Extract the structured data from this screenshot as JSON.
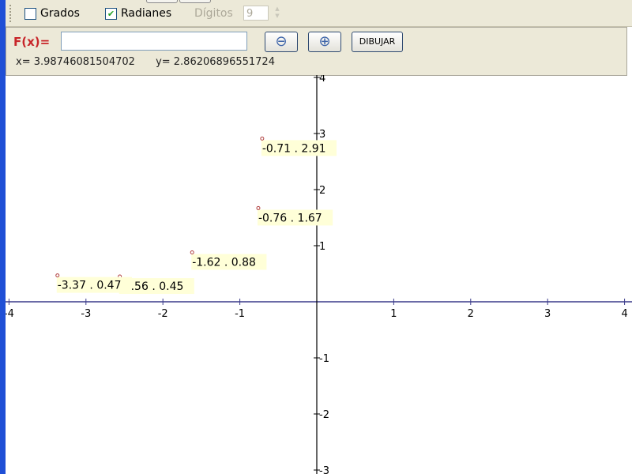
{
  "toolbar": {
    "grados_label": "Grados",
    "grados_checked": false,
    "radianes_label": "Radianes",
    "radianes_checked": true,
    "digitos_label": "Dígitos",
    "digitos_value": "9"
  },
  "panel": {
    "fx_label": "F(x)=",
    "fx_value": "",
    "zoom_out_icon": "⊖",
    "zoom_in_icon": "⊕",
    "draw_label": "DIBUJAR",
    "x_readout": "x= 3.98746081504702",
    "y_readout": "y= 2.86206896551724"
  },
  "chart_data": {
    "type": "scatter",
    "xlim": [
      -4,
      4
    ],
    "ylim": [
      -3,
      4
    ],
    "x_ticks": [
      "-4",
      "-3",
      "-2",
      "-1",
      "1",
      "2",
      "3",
      "4"
    ],
    "y_ticks": [
      "4",
      "3",
      "2",
      "1",
      "-1",
      "-2",
      "-3"
    ],
    "points": [
      {
        "x": -0.71,
        "y": 2.91,
        "label": "-0.71 . 2.91"
      },
      {
        "x": -0.76,
        "y": 1.67,
        "label": "-0.76 . 1.67"
      },
      {
        "x": -1.62,
        "y": 0.88,
        "label": "-1.62 . 0.88"
      },
      {
        "x": -2.56,
        "y": 0.45,
        "label": "-2.56 . 0.45"
      },
      {
        "x": -3.37,
        "y": 0.47,
        "label": "-3.37 . 0.47"
      }
    ],
    "colors": {
      "x_axis": "#3a3a8a",
      "y_axis": "#000000",
      "point": "#b04040",
      "label_bg": "#ffffd8"
    }
  }
}
